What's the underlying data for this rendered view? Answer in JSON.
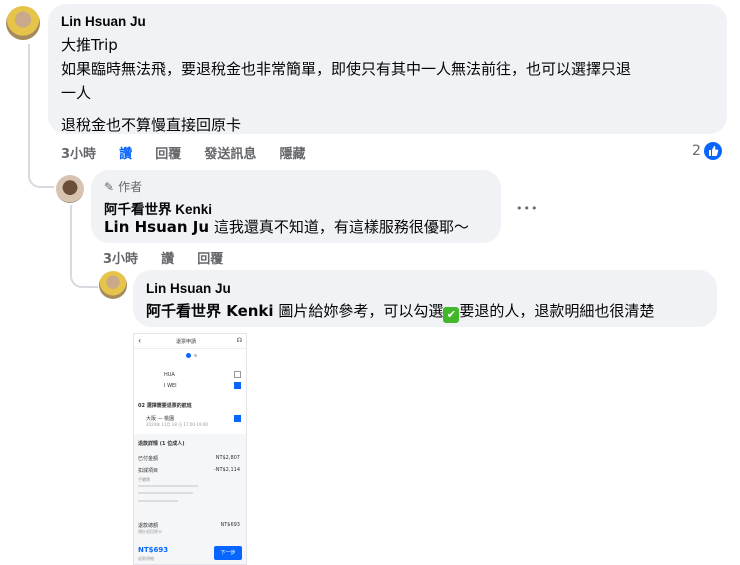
{
  "comment1": {
    "author": "Lin Hsuan Ju",
    "lines": [
      "大推Trip",
      "如果臨時無法飛，要退稅金也非常簡單，即使只有其中一人無法前往，也可以選擇只退",
      "一人",
      "退稅金也不算慢直接回原卡"
    ],
    "actions": {
      "time": "3小時",
      "like": "讚",
      "reply": "回覆",
      "send": "發送訊息",
      "hide": "隱藏"
    },
    "reaction_count": "2"
  },
  "comment2": {
    "badge": "作者",
    "author": "阿千看世界 Kenki",
    "mention": "Lin Hsuan Ju",
    "text": " 這我還真不知道，有這樣服務很優耶～",
    "more": "•••",
    "actions": {
      "time": "3小時",
      "like": "讚",
      "reply": "回覆"
    }
  },
  "comment3": {
    "author": "Lin Hsuan Ju",
    "mention": "阿千看世界 Kenki",
    "text_a": " 圖片給妳參考，可以勾選",
    "emoji": "✔",
    "text_b": "要退的人，退款明細也很清楚"
  },
  "screenshot": {
    "title": "退票申請",
    "row1": "HUA",
    "row2": "I WEI",
    "section": "02 選擇需要退票的航班",
    "flight": "大阪 — 桃園",
    "flight_sub": "2024年 11月 18 日 17:00-19:00",
    "detail_title": "退款詳情 (1 位成人)",
    "paid_label": "已付金額",
    "paid_value": "NT$2,807",
    "deduct_label": "扣減項目",
    "deduct_value": "-NT$2,114",
    "fee_label": "手續費",
    "refund_label": "退款總額",
    "refund_value": "NT$693",
    "refund_sub": "預計退回原卡",
    "total": "NT$693",
    "total_sub": "退款明細",
    "next": "下一步"
  },
  "colors": {
    "accent": "#0866ff",
    "bubble": "#f0f2f5",
    "gray": "#65676b",
    "check": "#42b72a"
  }
}
